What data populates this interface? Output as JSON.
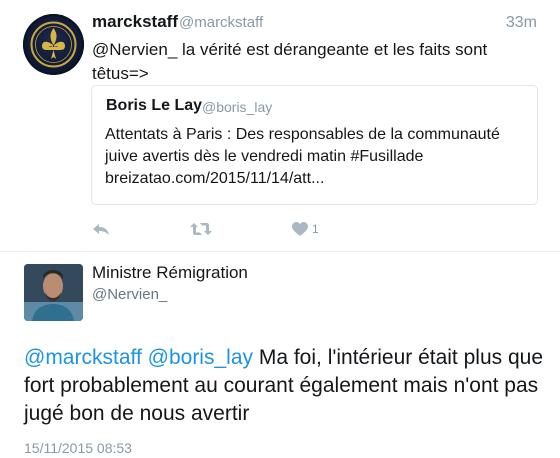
{
  "tweet1": {
    "author_name": "marckstaff",
    "author_handle": "@marckstaff",
    "time_ago": "33m",
    "text": "@Nervien_ la vérité est dérangeante et les faits sont têtus=>",
    "avatar_icon": "fleur-de-lis-emblem-icon",
    "quoted": {
      "author_name": "Boris Le Lay",
      "author_handle": "@boris_lay",
      "text_line1": "Attentats à Paris : Des responsables de la communauté",
      "text_line2": "juive avertis dès le vendredi matin #Fusillade",
      "text_line3": "breizatao.com/2015/11/14/att..."
    },
    "actions": {
      "reply_icon": "reply-icon",
      "retweet_icon": "retweet-icon",
      "like_icon": "heart-icon",
      "like_count": "1"
    }
  },
  "tweet2": {
    "author_name": "Ministre Rémigration",
    "author_handle": "@Nervien_",
    "mention1": "@marckstaff",
    "mention2": "@boris_lay",
    "text": "Ma foi, l'intérieur était plus que fort probablement au courant également mais n'ont pas jugé bon de nous avertir",
    "timestamp": "15/11/2015 08:53"
  },
  "colors": {
    "link": "#1b95e0",
    "muted": "#8899a6",
    "text": "#14171a",
    "border": "#e1e8ed"
  }
}
